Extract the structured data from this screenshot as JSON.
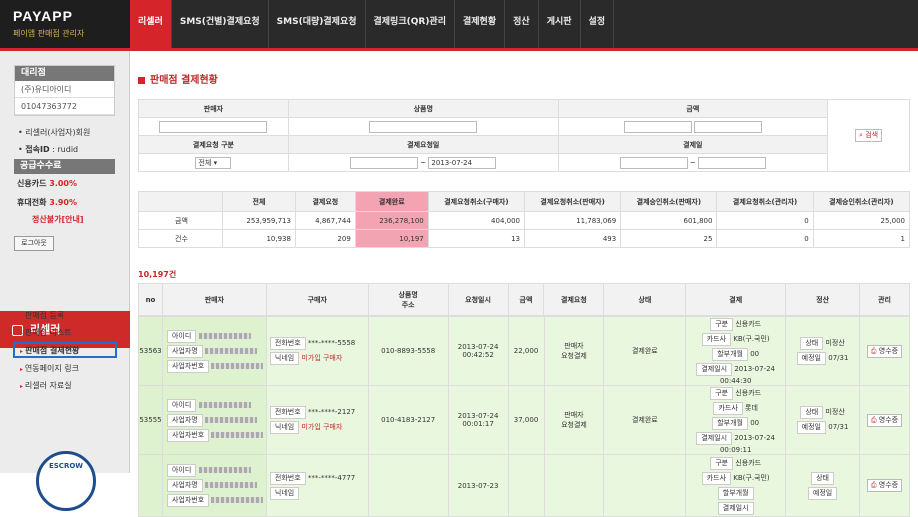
{
  "logo": {
    "title": "PAYAPP",
    "subtitle": "페이앱 판매점 관리자"
  },
  "nav": {
    "items": [
      "리셀러",
      "SMS(건별)결제요청",
      "SMS(대량)결제요청",
      "결제링크(QR)관리",
      "결제현황",
      "정산",
      "게시판",
      "설정"
    ]
  },
  "side": {
    "agency_header": "대리점",
    "agency_name": "(주)유디아이디",
    "agency_phone": "01047363772",
    "member": "리셀러(사업자)회원",
    "login_id_label": "접속ID",
    "login_id": "rudid",
    "fee_header": "공급수수료",
    "card_label": "신용카드",
    "card_rate": "3.00%",
    "phone_label": "휴대전화",
    "phone_rate": "3.90%",
    "settle_notice": "정산불가[안내]",
    "logout": "로그아웃",
    "reseller_title": "리셀러",
    "menu": [
      "판매점 등록",
      "판매점 리스트",
      "판매점 결제현황",
      "연동페이지 링크",
      "리셀러 자료실"
    ],
    "escrow": "ESCROW"
  },
  "main": {
    "title": "판매점 결제현황",
    "search": {
      "seller": "판매자",
      "product": "상품명",
      "amount": "금액",
      "req_type": "결제요청 구분",
      "req_date": "결제요청일",
      "pay_date": "결제일",
      "req_type_value": "전체",
      "date_to": "2013-07-24",
      "tilde": "~",
      "search_btn": "검색"
    },
    "summary": {
      "headers": [
        "전체",
        "결제요청",
        "결제완료",
        "결제요청취소(구매자)",
        "결제요청취소(판매자)",
        "결제승인취소(판매자)",
        "결제요청취소(관리자)",
        "결제승인취소(관리자)"
      ],
      "rows": [
        {
          "label": "금액",
          "values": [
            "253,959,713",
            "4,867,744",
            "236,278,100",
            "404,000",
            "11,783,069",
            "601,800",
            "0",
            "25,000"
          ]
        },
        {
          "label": "건수",
          "values": [
            "10,938",
            "209",
            "10,197",
            "13",
            "493",
            "25",
            "0",
            "1"
          ]
        }
      ]
    },
    "count": "10,197건",
    "list_headers": [
      "no",
      "판매자",
      "구매자",
      "상품명\n주소",
      "요청일시",
      "금액",
      "결제요청",
      "상태",
      "결제",
      "정산",
      "관리"
    ],
    "seller_labels": [
      "아이디",
      "사업자명",
      "사업자번호"
    ],
    "buyer_labels": [
      "전화번호",
      "닉네임"
    ],
    "pay_labels": [
      "구분",
      "카드사",
      "할부개월",
      "결제일시"
    ],
    "settle_labels": [
      "상태",
      "예정일"
    ],
    "receipt": "영수증",
    "rows": [
      {
        "no": "53563",
        "buyer_phone": "***-****-5558",
        "buyer_nick": "미가입 구매자",
        "product": "010-8893-5558",
        "req_date": "2013-07-24",
        "req_time": "00:42:52",
        "amount": "22,000",
        "req_state": "판매자\n요청결제",
        "state": "결제완료",
        "pay_type": "신용카드",
        "card": "KB(구.국민)",
        "inst": "00",
        "pay_date": "2013-07-24",
        "pay_time": "00:44:30",
        "settle": "미정산",
        "settle_date": "07/31"
      },
      {
        "no": "53555",
        "buyer_phone": "***-****-2127",
        "buyer_nick": "미가입 구매자",
        "product": "010-4183-2127",
        "req_date": "2013-07-24",
        "req_time": "00:01:17",
        "amount": "37,000",
        "req_state": "판매자\n요청결제",
        "state": "결제완료",
        "pay_type": "신용카드",
        "card": "롯데",
        "inst": "00",
        "pay_date": "2013-07-24",
        "pay_time": "00:09:11",
        "settle": "미정산",
        "settle_date": "07/31"
      },
      {
        "no": "",
        "buyer_phone": "***-****-4777",
        "buyer_nick": "",
        "product": "",
        "req_date": "2013-07-23",
        "req_time": "",
        "amount": "",
        "req_state": "",
        "state": "",
        "pay_type": "신용카드",
        "card": "KB(구.국민)",
        "inst": "",
        "pay_date": "",
        "pay_time": "",
        "settle": "",
        "settle_date": ""
      }
    ]
  }
}
